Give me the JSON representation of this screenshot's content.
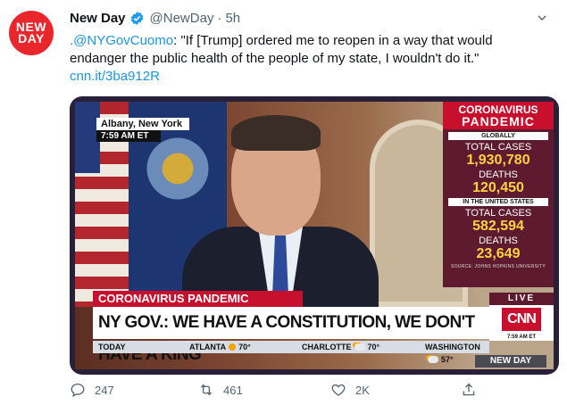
{
  "account": {
    "avatar_line1": "NEW",
    "avatar_line2": "DAY",
    "display_name": "New Day",
    "handle": "@NewDay",
    "separator": "·",
    "time": "5h"
  },
  "tweet": {
    "mention": ".@NYGovCuomo",
    "text": ": \"If [Trump] ordered me to reopen in a way that would endanger the public health of the people of my state, I wouldn't do it.\"",
    "link": "cnn.it/3ba912R"
  },
  "broadcast": {
    "location": "Albany, New York",
    "time": "7:59 AM ET",
    "panel": {
      "title_line1": "CORONAVIRUS",
      "title_line2": "PANDEMIC",
      "globally": "GLOBALLY",
      "total_cases_label": "TOTAL CASES",
      "global_cases": "1,930,780",
      "deaths_label": "DEATHS",
      "global_deaths": "120,450",
      "us_label": "IN THE UNITED STATES",
      "us_cases": "582,594",
      "us_deaths": "23,649",
      "source": "SOURCE: JOHNS HOPKINS UNIVERSITY"
    },
    "banner": "CORONAVIRUS PANDEMIC",
    "headline": "NY GOV.: WE HAVE A CONSTITUTION, WE DON'T HAVE A KING",
    "live": "LIVE",
    "network": "CNN",
    "network_time": "7:59 AM ET",
    "ticker": {
      "today": "TODAY",
      "city1": "ATLANTA",
      "temp1": "70°",
      "city2": "CHARLOTTE",
      "temp2": "70°",
      "city3": "WASHINGTON",
      "temp3": "57°"
    },
    "show_label": "NEW DAY"
  },
  "actions": {
    "replies": "247",
    "retweets": "461",
    "likes": "2K"
  },
  "colors": {
    "link": "#1b95e0",
    "brand_red": "#c8102e",
    "muted": "#536471"
  }
}
